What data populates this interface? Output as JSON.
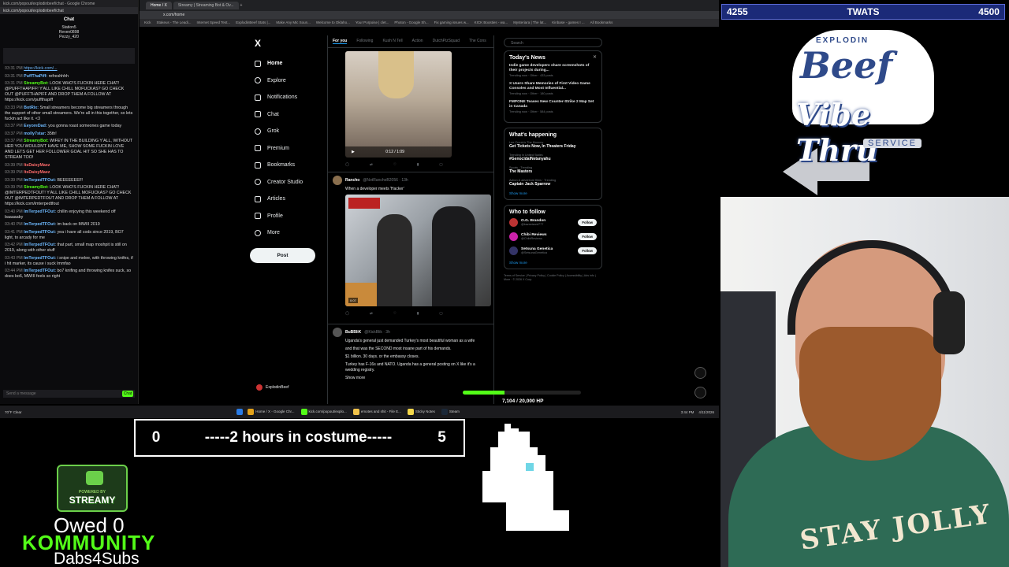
{
  "chat_window": {
    "title": "kick.com/popout/explodinbeef/chat - Google Chrome",
    "url": "kick.com/popout/explodinbeef/chat",
    "header": "Chat",
    "top_gifters": [
      "Station5",
      "Reven0898",
      "Pezzy_420"
    ],
    "input_placeholder": "Send a message",
    "send_label": "Chat",
    "lines": [
      {
        "time": "03:31 PM",
        "user": "",
        "text": "https://kick.com/...",
        "link": true
      },
      {
        "time": "03:31 PM",
        "user": "PuffThaPiff:",
        "text": "refreshhhh"
      },
      {
        "time": "03:31 PM",
        "user": "StreamyBot:",
        "text": "LOOK WHO'S FUCKIN HERE CHAT! @PUFFTHAPIFF! Y'ALL LIKE CHILL MOFUCKAS? GO CHECK OUT @PUFFTHAPIFF AND DROP THEM A FOLLOW AT https://kick.com/puffthapiff"
      },
      {
        "time": "03:33 PM",
        "user": "BotRix:",
        "text": "Small streamers become big streamers through the support of other small streamers. We're all in this together, so lets fuckin act like it. <3"
      },
      {
        "time": "03:37 PM",
        "user": "EeyoreDad:",
        "text": "you gonna roast someones game today"
      },
      {
        "time": "03:37 PM",
        "user": "molly7star:",
        "text": "35th!"
      },
      {
        "time": "03:37 PM",
        "user": "StreamyBot:",
        "text": "WIFEY IN THE BUILDING Y'ALL, WITHOUT HER YOU WOULDN'T HAVE ME, SHOW SOME FUCKIN LOVE AND LETS GET HER FOLLOWER GOAL HIT SO SHE HAS TO STREAM TOO!"
      },
      {
        "time": "03:39 PM",
        "user": "ItsDaisyMaez",
        "text": ""
      },
      {
        "time": "03:39 PM",
        "user": "ItsDaisyMaez",
        "text": ""
      },
      {
        "time": "03:39 PM",
        "user": "ImTerpedTFOut:",
        "text": "BEEEEEEEF!"
      },
      {
        "time": "03:39 PM",
        "user": "StreamyBot:",
        "text": "LOOK WHO'S FUCKIN HERE CHAT! @IMTERPEDTFOUT! Y'ALL LIKE CHILL MOFUCKAS? GO CHECK OUT @IMTERPEDTFOUT AND DROP THEM A FOLLOW AT https://kick.com/imterpedtfout"
      },
      {
        "time": "03:40 PM",
        "user": "ImTerpedTFOut:",
        "text": "chillin enjoying this weekend off baaaaaby"
      },
      {
        "time": "03:40 PM",
        "user": "ImTerpedTFOut:",
        "text": "im back on MWIII 2019"
      },
      {
        "time": "03:41 PM",
        "user": "ImTerpedTFOut:",
        "text": "yea i have all cods since 2019, BO7 light, to arcady for me"
      },
      {
        "time": "03:42 PM",
        "user": "ImTerpedTFOut:",
        "text": "that part, small map moshpit is still on 2019, along with other stuff"
      },
      {
        "time": "03:43 PM",
        "user": "ImTerpedTFOut:",
        "text": "i snipe and melee, with throwing knifes, if i hit marker, its cause i suck lmmfao"
      },
      {
        "time": "03:44 PM",
        "user": "ImTerpedTFOut:",
        "text": "bo7 knifing and throwing knifes suck, so does bo6, MWIII feels so right"
      }
    ]
  },
  "browser": {
    "tabs": [
      "Home / X",
      "Streamy | Streaming Bot & Ov...",
      "+"
    ],
    "url": "x.com/home",
    "bookmarks": [
      "Kick",
      "Stakeus - The Leadi...",
      "Internet Speed Test...",
      "ExplodinBeef Stats |...",
      "Make Any Mic Soun...",
      "Welcome to Oklaho...",
      "Your Porpoise | clet...",
      "Photon - Google Sh...",
      "Fix gaming issues w...",
      "KICK Boosties - wa...",
      "Mysteriara | The lat...",
      "Kinbase - games I ...",
      "All Bookmarks"
    ]
  },
  "x_nav": {
    "logo": "X",
    "items": [
      "Home",
      "Explore",
      "Notifications",
      "Chat",
      "Grok",
      "Premium",
      "Bookmarks",
      "Creator Studio",
      "Articles",
      "Profile",
      "More"
    ],
    "post_label": "Post",
    "profile_name": "ExplodinBeef"
  },
  "feed": {
    "tabs": [
      "For you",
      "Following",
      "Kush N Tell",
      "Action",
      "DutchPizSquad",
      "The Cons"
    ],
    "video1_time": "0:12 / 1:09",
    "post1": {
      "name": "Rancho",
      "handle": "@NotRanchoB2056 · 13h",
      "text": "When a developer meets 'Hacker'",
      "duration": "0:07"
    },
    "post2": {
      "name": "BuBBliK",
      "handle": "@KickBlik · 3h",
      "lines": [
        "Uganda's general just demanded Turkey's most beautiful woman as a wife",
        "and that was the SECOND most insane part of his demands.",
        "$1 billion. 30 days. or the embassy closes.",
        "Turkey has F-16s and NATO. Uganda has a general posting on X like it's a wedding registry."
      ],
      "show_more": "Show more"
    }
  },
  "right_col": {
    "search": "Search",
    "news_title": "Today's News",
    "news": [
      {
        "headline": "Indie game developers share screenshots of their projects during...",
        "meta": "Trending now · Other · 433 posts"
      },
      {
        "headline": "X Users Share Memories of First Video Game Consoles and Most Influential...",
        "meta": "Trending now · Other · 180 posts"
      },
      {
        "headline": "FMPONE Teases New Counter-Strike 2 Map Set in Canada",
        "meta": "Trending now · Other · 584 posts"
      }
    ],
    "happening_title": "What's happening",
    "trends": [
      {
        "category": "Lee Cronin's The Mummy",
        "name": "Get Tickets Now, In Theaters Friday"
      },
      {
        "category": "Trending in United States",
        "name": "#GenocidalNetanyahu"
      },
      {
        "category": "Sports · Trending",
        "name": "The Masters"
      },
      {
        "category": "Action & adventure films · Trending",
        "name": "Captain Jack Sparrow"
      }
    ],
    "show_more": "Show more",
    "wtf_title": "Who to follow",
    "wtf": [
      {
        "name": "O.G. Brandon",
        "handle": "@kazrwizard777",
        "color": "#b33"
      },
      {
        "name": "Chibi Reviews",
        "handle": "@ChibiReviews",
        "color": "#c2a"
      },
      {
        "name": "Setsuna Genetica",
        "handle": "@SetsunaGenetica",
        "color": "#336"
      }
    ],
    "follow_label": "Follow",
    "legal": "Terms of Service | Privacy Policy | Cookie Policy | Accessibility | Ads info | More · © 2026 X Corp."
  },
  "hp": {
    "text": "7,104 / 20,000 HP",
    "current": 7104,
    "max": 20000
  },
  "taskbar": {
    "weather": "70°F Clear",
    "items": [
      "Home / X - Google Chr...",
      "kick.com/popout/explo...",
      "emotes and shit - File E...",
      "Sticky Notes",
      "Steam"
    ],
    "time": "3:44 PM",
    "date": "4/11/2026"
  },
  "scorebar": {
    "left": "4255",
    "center": "TWATS",
    "right": "4500"
  },
  "logo": {
    "top": "EXPLODIN",
    "main": "Beef",
    "sub": "Vibe Thru",
    "tag": "SERVICE"
  },
  "timer": {
    "left": "0",
    "text": "-----2 hours in costume-----",
    "right": "5"
  },
  "streamy": {
    "small": "POWERED BY",
    "big": "STREAMY"
  },
  "owed": "Owed 0",
  "community": "KOMMUNITY",
  "dabs": "Dabs4Subs",
  "shirt_text": "STAY JOLLY"
}
